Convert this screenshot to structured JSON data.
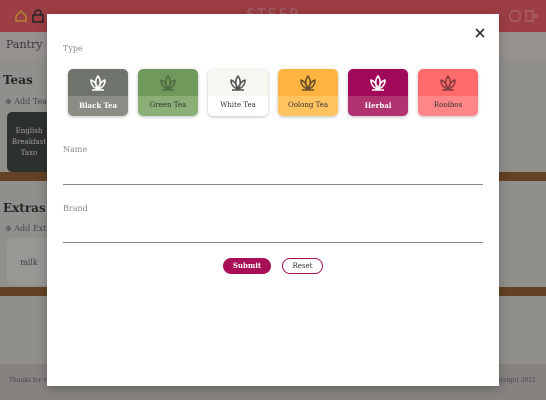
{
  "app": {
    "brand": "STEEP",
    "subbar_label": "Pantry",
    "teas_title": "Teas",
    "add_tea": "⊕ Add Tea",
    "bg_tea_card": "English Breakfast",
    "bg_tea_card_sub": "Taxo",
    "extras_title": "Extras",
    "add_extra": "⊕ Add Extra",
    "bg_extra_card": "milk",
    "footer_left": "Thanks for vi",
    "footer_right": "opyright 2021"
  },
  "modal": {
    "type_label": "Type",
    "name_label": "Name",
    "name_value": "",
    "brand_label": "Brand",
    "brand_value": "",
    "submit_label": "Submit",
    "reset_label": "Reset",
    "types": [
      {
        "label": "Black Tea",
        "top_color": "#6e736c",
        "bottom_color": "#8a8d86",
        "text_color": "#ffffff",
        "icon_color": "#ffffff"
      },
      {
        "label": "Green Tea",
        "top_color": "#6f9a5c",
        "bottom_color": "#8bb077",
        "text_color": "#333333",
        "icon_color": "#506c44"
      },
      {
        "label": "White Tea",
        "top_color": "#f7f7f2",
        "bottom_color": "#ffffff",
        "text_color": "#333333",
        "icon_color": "#555555"
      },
      {
        "label": "Oolong Tea",
        "top_color": "#ffb340",
        "bottom_color": "#ffc460",
        "text_color": "#333333",
        "icon_color": "#6b5228"
      },
      {
        "label": "Herbal",
        "top_color": "#a0095a",
        "bottom_color": "#b1336f",
        "text_color": "#ffffff",
        "icon_color": "#ffffff"
      },
      {
        "label": "Rooibos",
        "top_color": "#ff6b6b",
        "bottom_color": "#ff8686",
        "text_color": "#333333",
        "icon_color": "#8a3b3b"
      }
    ]
  },
  "colors": {
    "accent": "#a80f57",
    "topbar": "#d9565f"
  }
}
